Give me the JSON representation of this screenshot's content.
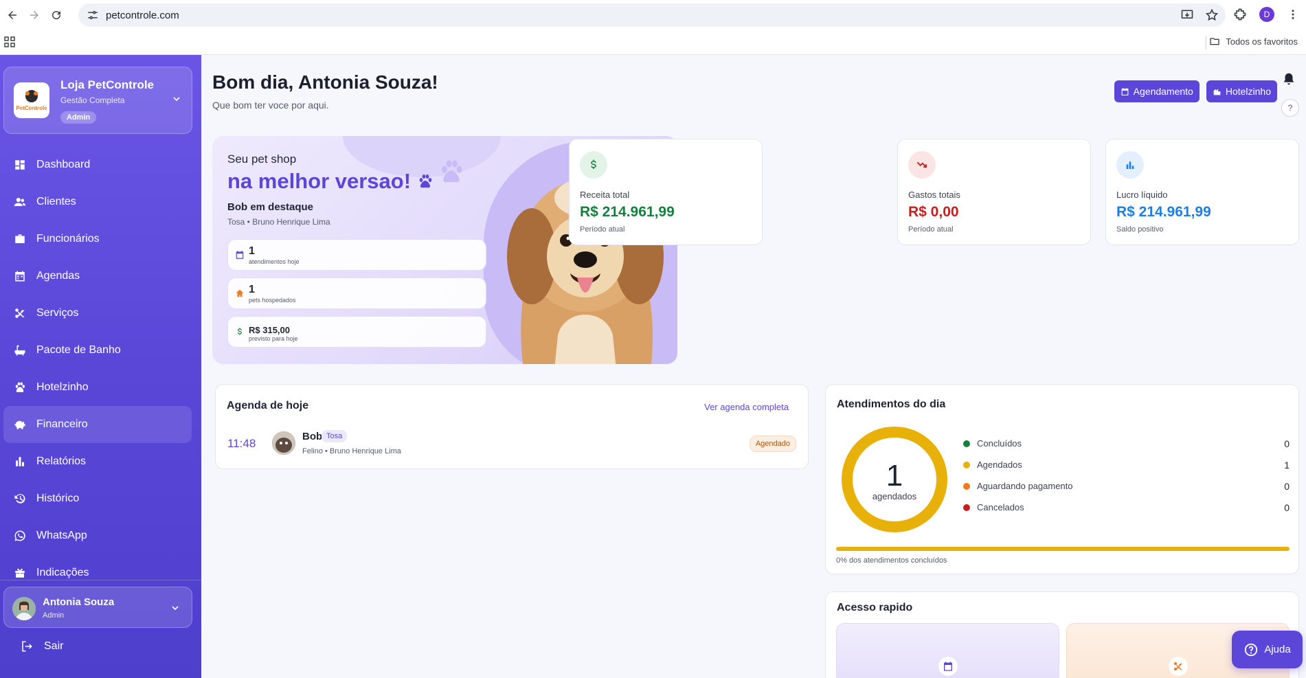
{
  "browser": {
    "url": "petcontrole.com",
    "profile_initial": "D",
    "bookmarks_label": "Todos os favoritos"
  },
  "store": {
    "name": "Loja PetControle",
    "subtitle": "Gestão Completa",
    "badge": "Admin",
    "logo_text": "PetControle"
  },
  "nav": {
    "items": [
      {
        "label": "Dashboard",
        "icon": "dashboard-icon"
      },
      {
        "label": "Clientes",
        "icon": "users-icon"
      },
      {
        "label": "Funcionários",
        "icon": "briefcase-icon"
      },
      {
        "label": "Agendas",
        "icon": "calendar-icon"
      },
      {
        "label": "Serviços",
        "icon": "scissors-icon"
      },
      {
        "label": "Pacote de Banho",
        "icon": "bath-icon"
      },
      {
        "label": "Hotelzinho",
        "icon": "paw-icon"
      },
      {
        "label": "Financeiro",
        "icon": "piggy-bank-icon",
        "active": true
      },
      {
        "label": "Relatórios",
        "icon": "bar-chart-icon"
      },
      {
        "label": "Histórico",
        "icon": "history-icon"
      },
      {
        "label": "WhatsApp",
        "icon": "whatsapp-icon"
      },
      {
        "label": "Indicações",
        "icon": "gift-icon"
      }
    ]
  },
  "user": {
    "name": "Antonia Souza",
    "role": "Admin",
    "logout_label": "Sair"
  },
  "header": {
    "greeting": "Bom dia, Antonia Souza!",
    "subtitle": "Que bom ter voce por aqui.",
    "btn_agendamento": "Agendamento",
    "btn_hotelzinho": "Hotelzinho",
    "help_mark": "?"
  },
  "hero": {
    "kicker": "Seu pet shop",
    "title": "na melhor versao!",
    "featured_title": "Bob em destaque",
    "featured_sub": "Tosa • Bruno Henrique Lima",
    "stats": [
      {
        "value": "1",
        "label": "atendimentos hoje",
        "icon": "calendar-icon"
      },
      {
        "value": "1",
        "label": "pets hospedados",
        "icon": "house-icon"
      },
      {
        "value": "R$ 315,00",
        "label": "previsto para hoje",
        "icon": "dollar-icon"
      }
    ]
  },
  "kpis": [
    {
      "title": "Receita total",
      "value": "R$ 214.961,99",
      "sub": "Período atual",
      "color": "#15803d",
      "bg": "#e3f3e8",
      "icon": "dollar-icon"
    },
    {
      "title": "Gastos totais",
      "value": "R$ 0,00",
      "sub": "Período atual",
      "color": "#c81e1e",
      "bg": "#fbe4e4",
      "icon": "trending-down-icon"
    },
    {
      "title": "Lucro líquido",
      "value": "R$ 214.961,99",
      "sub": "Saldo positivo",
      "color": "#1d7fe6",
      "bg": "#e3effc",
      "icon": "bar-chart-icon"
    }
  ],
  "agenda": {
    "title": "Agenda de hoje",
    "link": "Ver agenda completa",
    "items": [
      {
        "time": "11:48",
        "pet": "Bob",
        "tag": "Tosa",
        "sub": "Felino • Bruno Henrique Lima",
        "status": "Agendado"
      }
    ]
  },
  "atendimentos": {
    "title": "Atendimentos do dia",
    "center_value": "1",
    "center_label": "agendados",
    "legend": [
      {
        "label": "Concluídos",
        "count": "0",
        "color": "#15803d"
      },
      {
        "label": "Agendados",
        "count": "1",
        "color": "#e8b10a"
      },
      {
        "label": "Aguardando pagamento",
        "count": "0",
        "color": "#f0781f"
      },
      {
        "label": "Cancelados",
        "count": "0",
        "color": "#c81e1e"
      }
    ],
    "progress_fraction": 1,
    "progress_label": "0% dos atendimentos concluídos"
  },
  "quick": {
    "title": "Acesso rapido"
  },
  "help_fab": "Ajuda"
}
